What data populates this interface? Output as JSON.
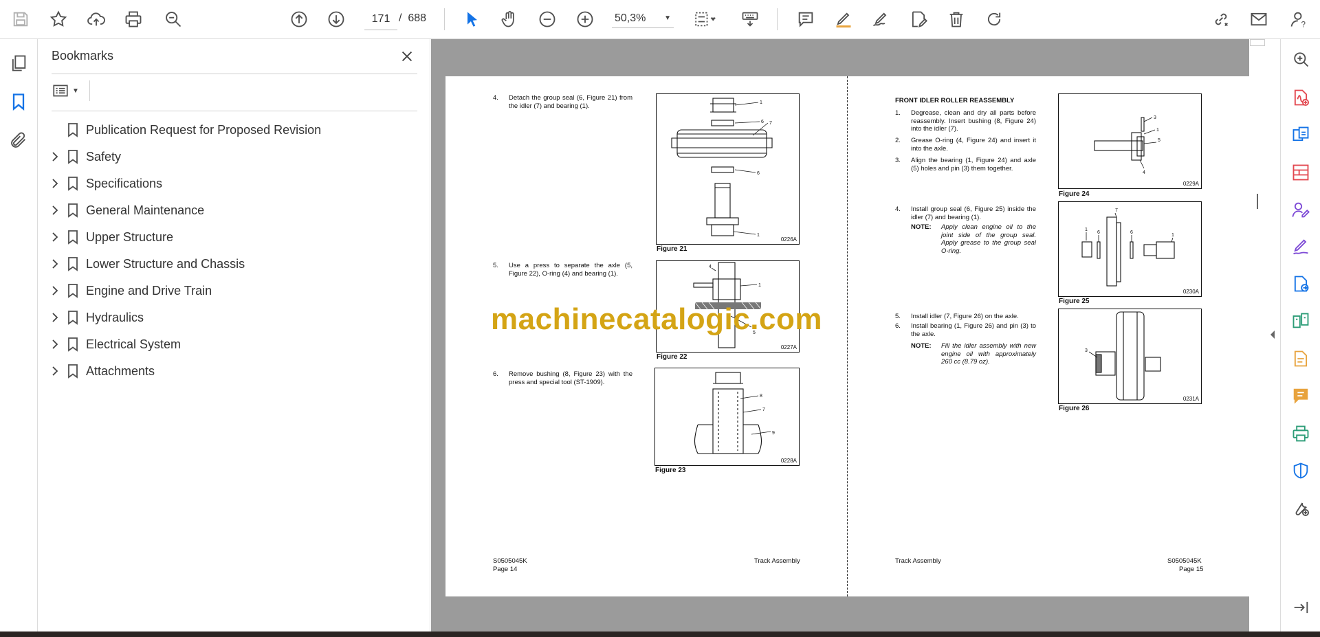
{
  "toolbar": {
    "page_current": "171",
    "page_separator": "/",
    "page_total": "688",
    "zoom": "50,3%"
  },
  "bookmarks": {
    "title": "Bookmarks",
    "items": [
      {
        "label": "Publication Request for Proposed Revision",
        "expandable": false
      },
      {
        "label": "Safety",
        "expandable": true
      },
      {
        "label": "Specifications",
        "expandable": true
      },
      {
        "label": "General Maintenance",
        "expandable": true
      },
      {
        "label": "Upper Structure",
        "expandable": true
      },
      {
        "label": "Lower Structure and Chassis",
        "expandable": true
      },
      {
        "label": "Engine and Drive Train",
        "expandable": true
      },
      {
        "label": "Hydraulics",
        "expandable": true
      },
      {
        "label": "Electrical System",
        "expandable": true
      },
      {
        "label": "Attachments",
        "expandable": true
      }
    ]
  },
  "document": {
    "left_page": {
      "steps": [
        {
          "num": "4.",
          "text": "Detach the group seal (6, Figure 21) from the idler (7) and bearing (1)."
        },
        {
          "num": "5.",
          "text": "Use a press to separate the axle (5, Figure 22), O-ring (4) and bearing (1)."
        },
        {
          "num": "6.",
          "text": "Remove bushing (8, Figure 23) with the press and special tool (ST-1909)."
        }
      ],
      "figures": [
        {
          "caption": "Figure 21",
          "code": "0226A"
        },
        {
          "caption": "Figure 22",
          "code": "0227A"
        },
        {
          "caption": "Figure 23",
          "code": "0228A"
        }
      ],
      "footer_doc": "S0505045K",
      "footer_page": "Page 14",
      "footer_section": "Track Assembly"
    },
    "right_page": {
      "heading": "FRONT IDLER ROLLER REASSEMBLY",
      "steps": [
        {
          "num": "1.",
          "text": "Degrease, clean and dry all parts before reassembly. Insert bushing (8, Figure 24) into the idler (7)."
        },
        {
          "num": "2.",
          "text": "Grease O-ring (4, Figure 24) and insert it into the axle."
        },
        {
          "num": "3.",
          "text": "Align the bearing (1, Figure 24) and axle (5) holes and pin (3) them together."
        },
        {
          "num": "4.",
          "text": "Install group seal (6, Figure 25) inside the idler (7) and bearing (1)."
        },
        {
          "num": "5.",
          "text": "Install idler (7, Figure 26) on the axle."
        },
        {
          "num": "6.",
          "text": "Install bearing (1, Figure 26) and pin (3) to the axle."
        }
      ],
      "notes": [
        {
          "label": "NOTE:",
          "text": "Apply clean engine oil to the joint side of the group seal. Apply grease to the group seal O-ring."
        },
        {
          "label": "NOTE:",
          "text": "Fill the idler assembly with new engine oil with approximately 260 cc (8.79 oz)."
        }
      ],
      "figures": [
        {
          "caption": "Figure 24",
          "code": "0229A"
        },
        {
          "caption": "Figure 25",
          "code": "0230A"
        },
        {
          "caption": "Figure 26",
          "code": "0231A"
        }
      ],
      "footer_section": "Track Assembly",
      "footer_doc": "S0505045K",
      "footer_page": "Page 15"
    },
    "watermark": "machinecatalogic.com",
    "callouts": {
      "fig21": [
        "1",
        "6",
        "7",
        "6",
        "1"
      ],
      "fig22": [
        "4",
        "1",
        "5"
      ],
      "fig23": [
        "8",
        "7",
        "9"
      ],
      "fig24": [
        "3",
        "1",
        "5",
        "4"
      ],
      "fig25": [
        "1",
        "6",
        "7",
        "6",
        "1"
      ],
      "fig26": [
        "3"
      ]
    }
  },
  "colors": {
    "accent_blue": "#1473e6",
    "doc_background": "#9b9b9b",
    "icon_gray": "#505050",
    "watermark": "#d4a415",
    "rail_red": "#e34850",
    "rail_purple": "#7e4bd6",
    "rail_green": "#2d9d78",
    "rail_yellow": "#e8a33d"
  }
}
